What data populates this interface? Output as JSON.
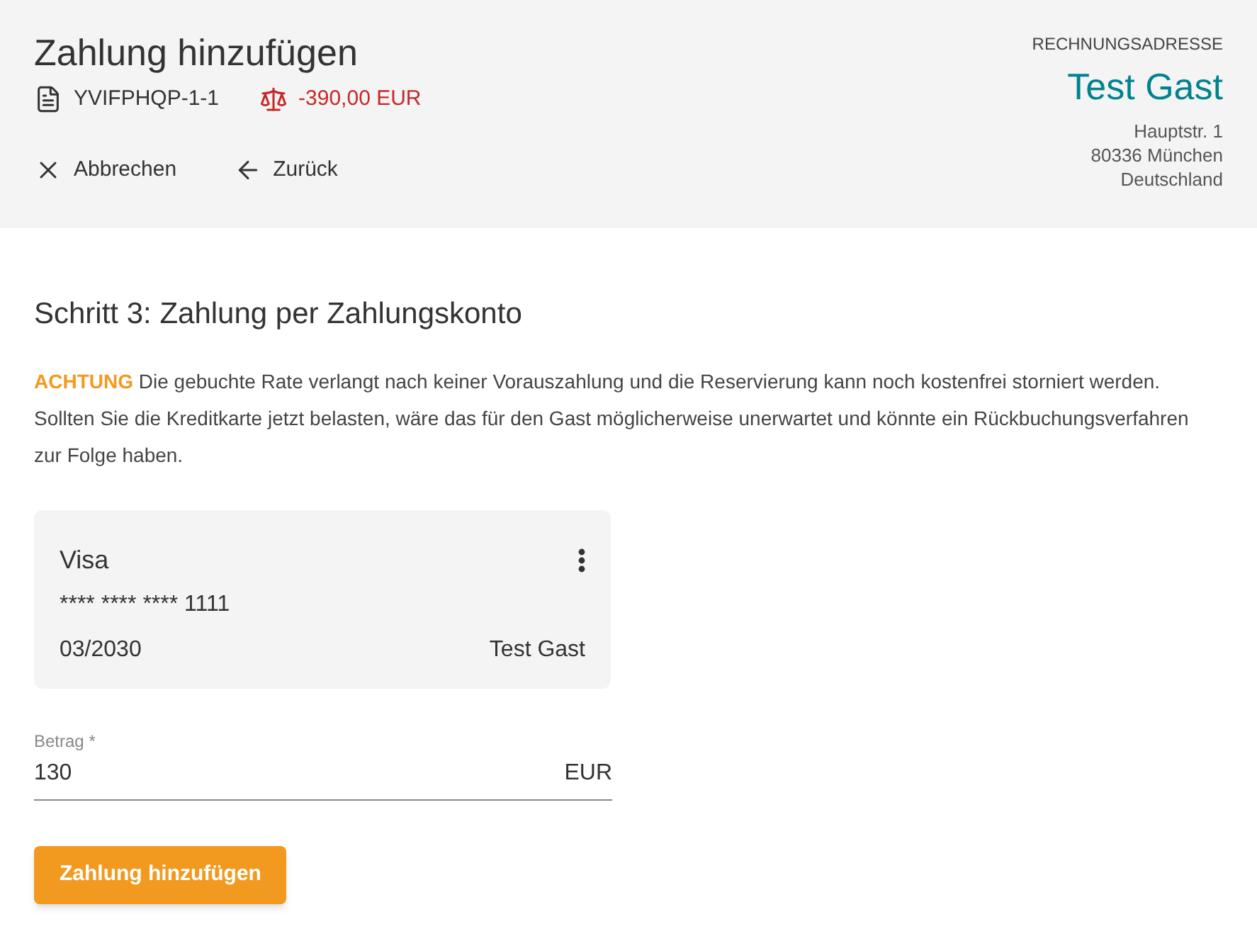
{
  "header": {
    "title": "Zahlung hinzufügen",
    "reference": "YVIFPHQP-1-1",
    "balance": "-390,00 EUR",
    "actions": [
      {
        "kind": "cancel",
        "label": "Abbrechen"
      },
      {
        "kind": "back",
        "label": "Zurück"
      }
    ]
  },
  "billing_address": {
    "heading": "RECHNUNGSADRESSE",
    "name": "Test Gast",
    "lines": [
      "Hauptstr. 1",
      "80336 München",
      "Deutschland"
    ]
  },
  "step_title": "Schritt 3: Zahlung per Zahlungskonto",
  "notice": {
    "label": "ACHTUNG",
    "text": "Die gebuchte Rate verlangt nach keiner Vorauszahlung und die Reservierung kann noch kostenfrei storniert werden. Sollten Sie die Kreditkarte jetzt belasten, wäre das für den Gast möglicherweise unerwartet und könnte ein Rückbuchungsverfahren zur Folge haben."
  },
  "card": {
    "brand": "Visa",
    "number": "**** **** **** 1111",
    "expiry": "03/2030",
    "holder": "Test Gast"
  },
  "amount_field": {
    "label": "Betrag *",
    "value": "130",
    "unit": "EUR"
  },
  "submit_button": "Zahlung hinzufügen"
}
